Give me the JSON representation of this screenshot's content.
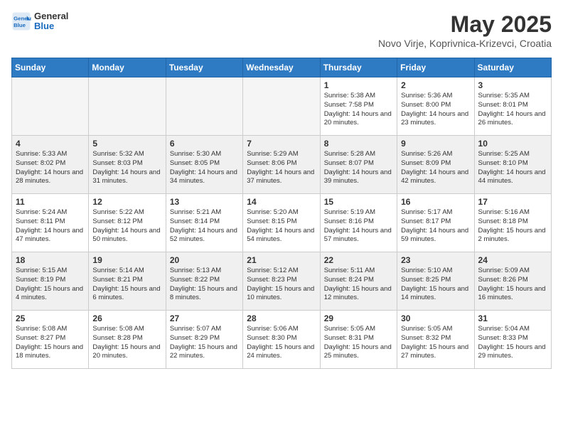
{
  "header": {
    "logo_line1": "General",
    "logo_line2": "Blue",
    "month_year": "May 2025",
    "location": "Novo Virje, Koprivnica-Krizevci, Croatia"
  },
  "days_of_week": [
    "Sunday",
    "Monday",
    "Tuesday",
    "Wednesday",
    "Thursday",
    "Friday",
    "Saturday"
  ],
  "weeks": [
    [
      {
        "day": "",
        "empty": true
      },
      {
        "day": "",
        "empty": true
      },
      {
        "day": "",
        "empty": true
      },
      {
        "day": "",
        "empty": true
      },
      {
        "day": "1",
        "sunrise": "5:38 AM",
        "sunset": "7:58 PM",
        "daylight": "14 hours and 20 minutes."
      },
      {
        "day": "2",
        "sunrise": "5:36 AM",
        "sunset": "8:00 PM",
        "daylight": "14 hours and 23 minutes."
      },
      {
        "day": "3",
        "sunrise": "5:35 AM",
        "sunset": "8:01 PM",
        "daylight": "14 hours and 26 minutes."
      }
    ],
    [
      {
        "day": "4",
        "sunrise": "5:33 AM",
        "sunset": "8:02 PM",
        "daylight": "14 hours and 28 minutes."
      },
      {
        "day": "5",
        "sunrise": "5:32 AM",
        "sunset": "8:03 PM",
        "daylight": "14 hours and 31 minutes."
      },
      {
        "day": "6",
        "sunrise": "5:30 AM",
        "sunset": "8:05 PM",
        "daylight": "14 hours and 34 minutes."
      },
      {
        "day": "7",
        "sunrise": "5:29 AM",
        "sunset": "8:06 PM",
        "daylight": "14 hours and 37 minutes."
      },
      {
        "day": "8",
        "sunrise": "5:28 AM",
        "sunset": "8:07 PM",
        "daylight": "14 hours and 39 minutes."
      },
      {
        "day": "9",
        "sunrise": "5:26 AM",
        "sunset": "8:09 PM",
        "daylight": "14 hours and 42 minutes."
      },
      {
        "day": "10",
        "sunrise": "5:25 AM",
        "sunset": "8:10 PM",
        "daylight": "14 hours and 44 minutes."
      }
    ],
    [
      {
        "day": "11",
        "sunrise": "5:24 AM",
        "sunset": "8:11 PM",
        "daylight": "14 hours and 47 minutes."
      },
      {
        "day": "12",
        "sunrise": "5:22 AM",
        "sunset": "8:12 PM",
        "daylight": "14 hours and 50 minutes."
      },
      {
        "day": "13",
        "sunrise": "5:21 AM",
        "sunset": "8:14 PM",
        "daylight": "14 hours and 52 minutes."
      },
      {
        "day": "14",
        "sunrise": "5:20 AM",
        "sunset": "8:15 PM",
        "daylight": "14 hours and 54 minutes."
      },
      {
        "day": "15",
        "sunrise": "5:19 AM",
        "sunset": "8:16 PM",
        "daylight": "14 hours and 57 minutes."
      },
      {
        "day": "16",
        "sunrise": "5:17 AM",
        "sunset": "8:17 PM",
        "daylight": "14 hours and 59 minutes."
      },
      {
        "day": "17",
        "sunrise": "5:16 AM",
        "sunset": "8:18 PM",
        "daylight": "15 hours and 2 minutes."
      }
    ],
    [
      {
        "day": "18",
        "sunrise": "5:15 AM",
        "sunset": "8:19 PM",
        "daylight": "15 hours and 4 minutes."
      },
      {
        "day": "19",
        "sunrise": "5:14 AM",
        "sunset": "8:21 PM",
        "daylight": "15 hours and 6 minutes."
      },
      {
        "day": "20",
        "sunrise": "5:13 AM",
        "sunset": "8:22 PM",
        "daylight": "15 hours and 8 minutes."
      },
      {
        "day": "21",
        "sunrise": "5:12 AM",
        "sunset": "8:23 PM",
        "daylight": "15 hours and 10 minutes."
      },
      {
        "day": "22",
        "sunrise": "5:11 AM",
        "sunset": "8:24 PM",
        "daylight": "15 hours and 12 minutes."
      },
      {
        "day": "23",
        "sunrise": "5:10 AM",
        "sunset": "8:25 PM",
        "daylight": "15 hours and 14 minutes."
      },
      {
        "day": "24",
        "sunrise": "5:09 AM",
        "sunset": "8:26 PM",
        "daylight": "15 hours and 16 minutes."
      }
    ],
    [
      {
        "day": "25",
        "sunrise": "5:08 AM",
        "sunset": "8:27 PM",
        "daylight": "15 hours and 18 minutes."
      },
      {
        "day": "26",
        "sunrise": "5:08 AM",
        "sunset": "8:28 PM",
        "daylight": "15 hours and 20 minutes."
      },
      {
        "day": "27",
        "sunrise": "5:07 AM",
        "sunset": "8:29 PM",
        "daylight": "15 hours and 22 minutes."
      },
      {
        "day": "28",
        "sunrise": "5:06 AM",
        "sunset": "8:30 PM",
        "daylight": "15 hours and 24 minutes."
      },
      {
        "day": "29",
        "sunrise": "5:05 AM",
        "sunset": "8:31 PM",
        "daylight": "15 hours and 25 minutes."
      },
      {
        "day": "30",
        "sunrise": "5:05 AM",
        "sunset": "8:32 PM",
        "daylight": "15 hours and 27 minutes."
      },
      {
        "day": "31",
        "sunrise": "5:04 AM",
        "sunset": "8:33 PM",
        "daylight": "15 hours and 29 minutes."
      }
    ]
  ]
}
